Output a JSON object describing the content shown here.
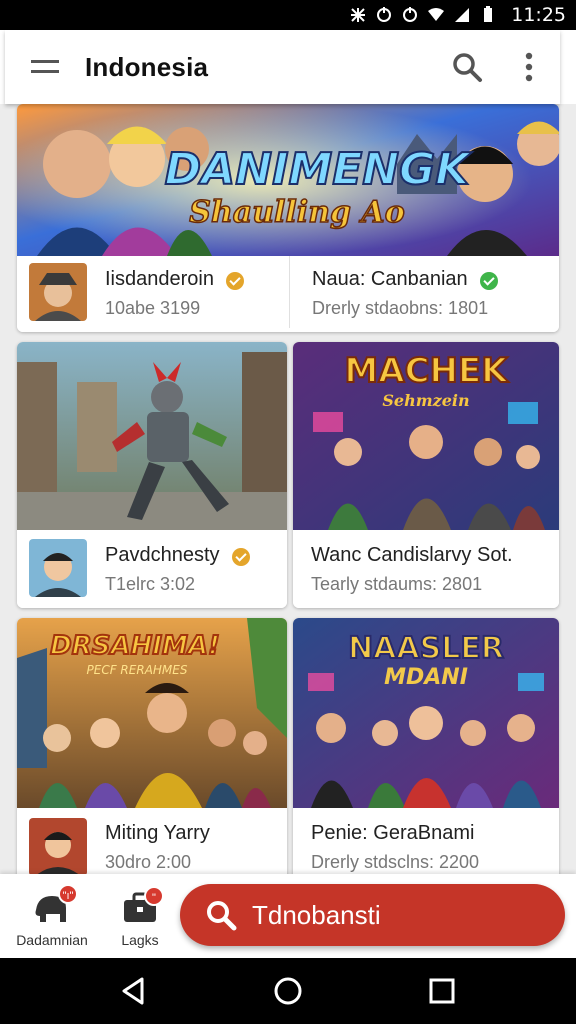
{
  "status_bar": {
    "time": "11:25"
  },
  "app_bar": {
    "title": "Indonesia"
  },
  "cards": [
    {
      "banner_title": "DANIMENGK",
      "banner_subtitle": "Shaulling Ao",
      "left": {
        "name": "Iisdanderoin",
        "meta": "10abe 3199",
        "verified_color": "#e4a52b"
      },
      "right": {
        "name": "Naua: Canbanian",
        "meta": "Drerly stdaobns: 1801",
        "verified_color": "#3fb54a"
      }
    },
    {
      "name": "Pavdchnesty",
      "meta": "T1elrc 3:02",
      "verified_color": "#e4a52b"
    },
    {
      "banner_title": "MACHEK",
      "banner_subtitle": "Sehmzein",
      "name": "Wanc Candislarvy Sot.",
      "meta": "Tearly stdaums: 2801"
    },
    {
      "banner_title": "DRSAHIMA!",
      "banner_subtitle": "PECF RERAHMES",
      "name": "Miting Yarry",
      "meta": "30dro 2:00"
    },
    {
      "banner_title": "NAASLER",
      "banner_subtitle": "MDANI",
      "name": "Penie: GeraBnami",
      "meta": "Drerly stdsclns: 2200"
    }
  ],
  "bottom_nav": {
    "tab1": {
      "label": "Dadamnian",
      "badge": "\"ı\""
    },
    "tab2": {
      "label": "Lagks",
      "badge": "\""
    },
    "action": {
      "label": "Tdnobansti"
    }
  },
  "colors": {
    "accent": "#c53528",
    "verified_gold": "#e4a52b",
    "verified_green": "#3fb54a"
  }
}
